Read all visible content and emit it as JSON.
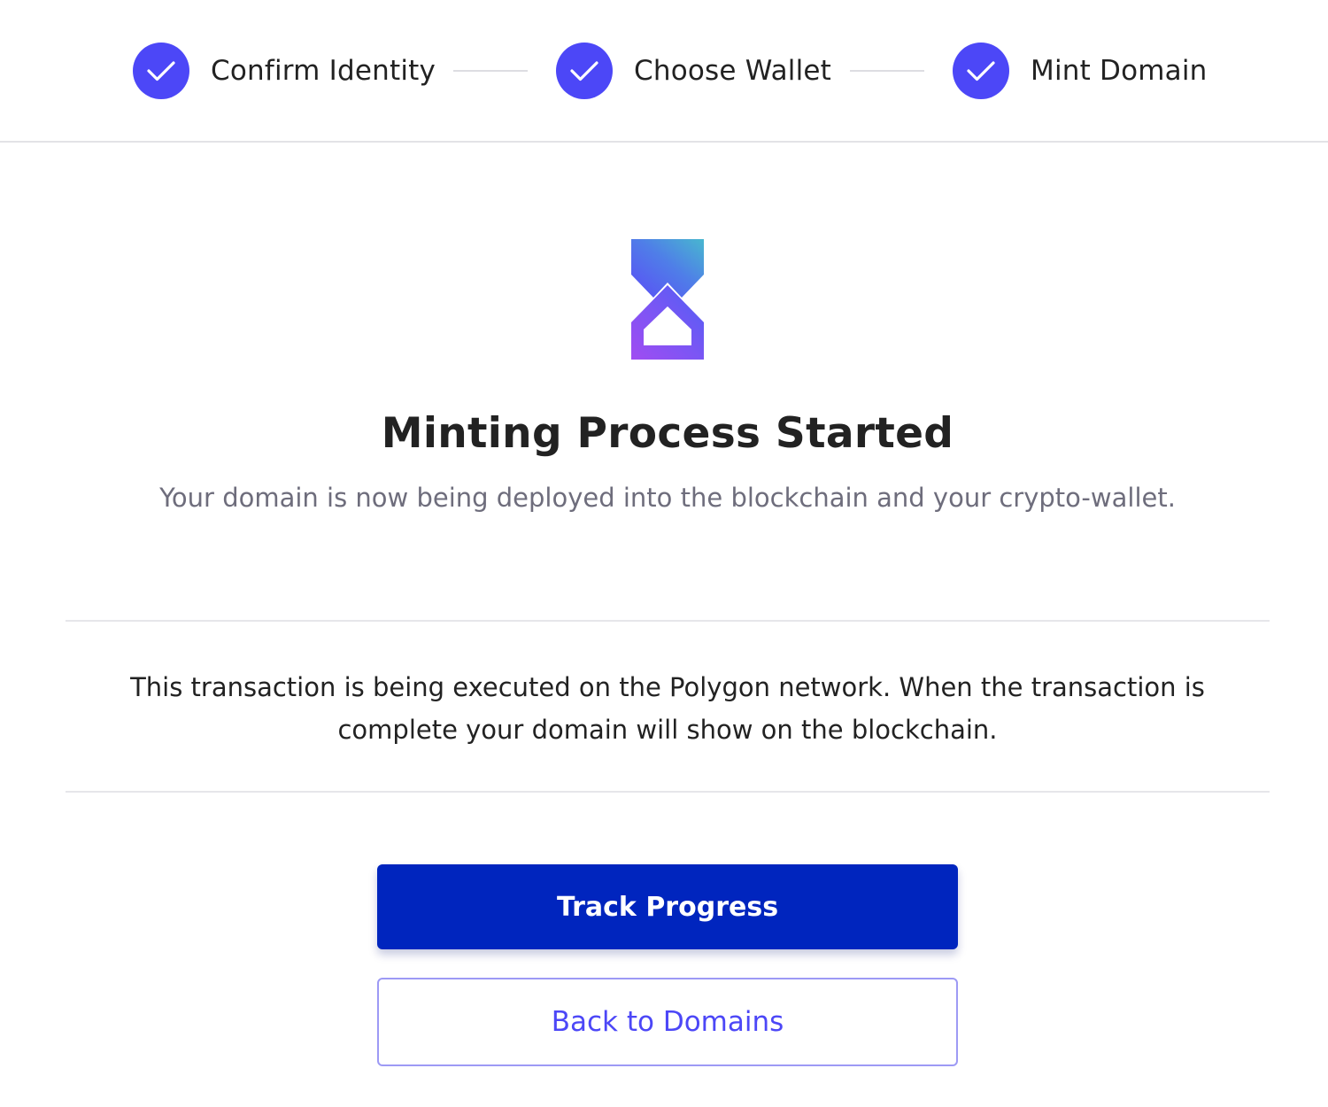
{
  "stepper": {
    "steps": [
      {
        "label": "Confirm Identity",
        "status": "complete"
      },
      {
        "label": "Choose Wallet",
        "status": "complete"
      },
      {
        "label": "Mint Domain",
        "status": "complete"
      }
    ]
  },
  "status": {
    "icon": "hourglass-icon",
    "title": "Minting Process Started",
    "subtitle": "Your domain is now being deployed into the blockchain and your crypto-wallet."
  },
  "info": {
    "text": "This transaction is being executed on the Polygon network. When the transaction is complete your domain will show on the blockchain."
  },
  "actions": {
    "track_label": "Track Progress",
    "back_label": "Back to Domains"
  },
  "colors": {
    "accent": "#4c47f7",
    "primary_button": "#0025be",
    "muted_text": "#6e6d7c"
  }
}
